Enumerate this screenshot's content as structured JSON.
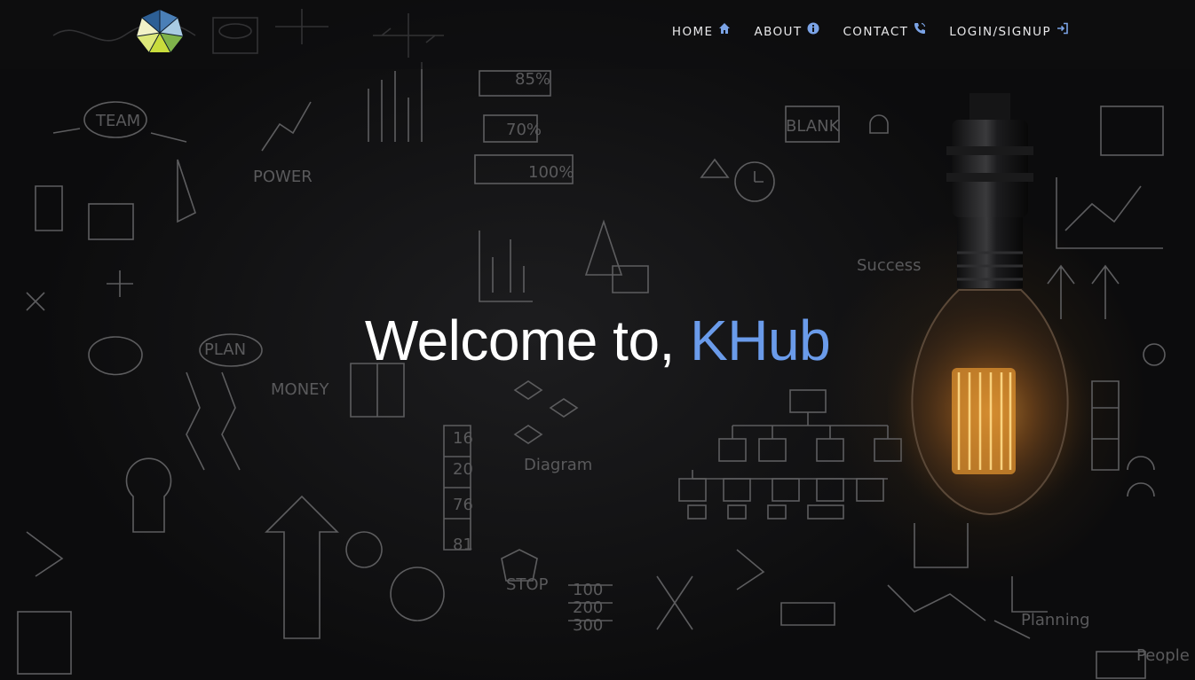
{
  "navbar": {
    "items": [
      {
        "label": "HOME",
        "icon": "home-icon"
      },
      {
        "label": "ABOUT",
        "icon": "info-icon"
      },
      {
        "label": "CONTACT",
        "icon": "phone-icon"
      },
      {
        "label": "LOGIN/SIGNUP",
        "icon": "sign-in-icon"
      }
    ]
  },
  "hero": {
    "welcome_text": "Welcome to,",
    "brand_text": "KHub"
  },
  "colors": {
    "accent": "#6a9bea",
    "background": "#0b0b0c",
    "text": "#ffffff"
  },
  "logo": {
    "icon": "heptagon-logo-icon"
  }
}
